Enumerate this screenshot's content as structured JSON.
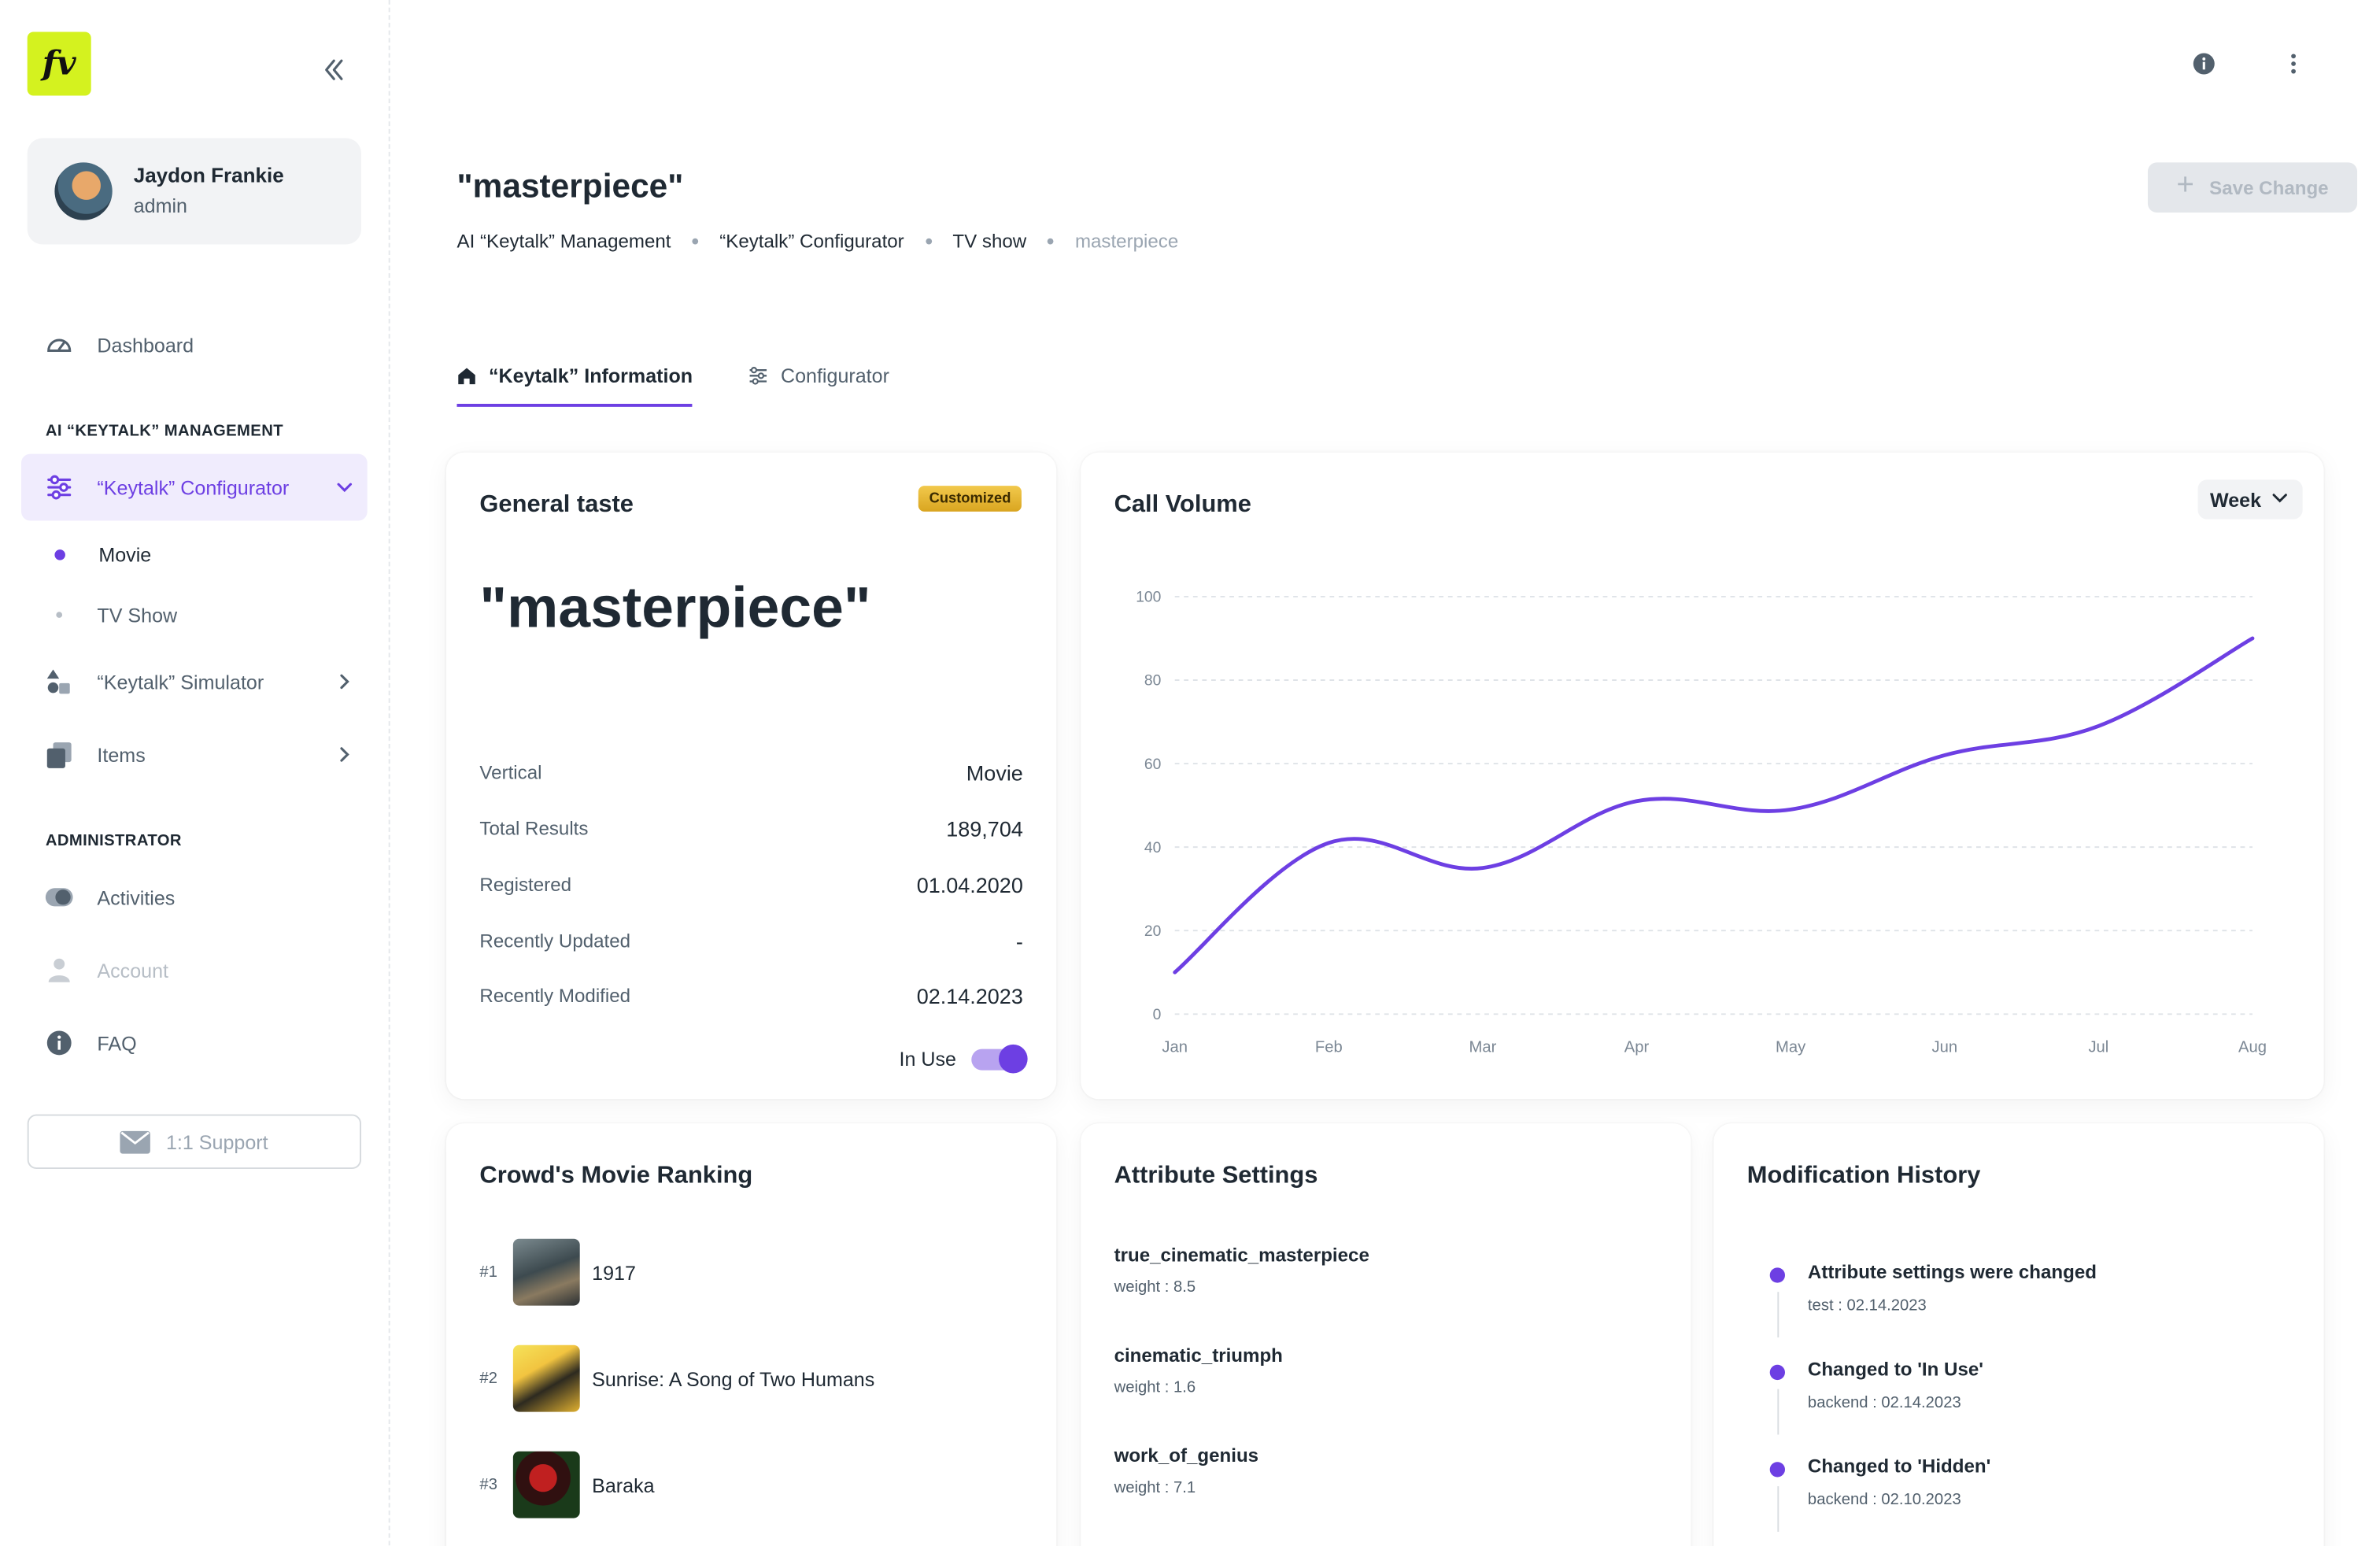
{
  "app": {
    "logo_text": "fv",
    "brand_color": "#d4f21f",
    "accent_color": "#6d3fe3"
  },
  "user": {
    "name": "Jaydon Frankie",
    "role": "admin"
  },
  "sidebar": {
    "dashboard": "Dashboard",
    "section_management": "AI “KEYTALK” MANAGEMENT",
    "configurator": "“Keytalk” Configurator",
    "sub_movie": "Movie",
    "sub_tvshow": "TV Show",
    "simulator": "“Keytalk” Simulator",
    "items": "Items",
    "section_admin": "ADMINISTRATOR",
    "activities": "Activities",
    "account": "Account",
    "faq": "FAQ",
    "support": "1:1 Support"
  },
  "header": {
    "title": "\"masterpiece\"",
    "breadcrumb": [
      "AI “Keytalk” Management",
      "“Keytalk” Configurator",
      "TV show",
      "masterpiece"
    ],
    "save_label": "Save Change"
  },
  "tabs": [
    {
      "label": "“Keytalk” Information",
      "icon": "home-icon",
      "active": true
    },
    {
      "label": "Configurator",
      "icon": "sliders-icon",
      "active": false
    }
  ],
  "general": {
    "title": "General taste",
    "badge": "Customized",
    "keyword": "\"masterpiece\"",
    "rows": [
      {
        "key": "Vertical",
        "value": "Movie"
      },
      {
        "key": "Total Results",
        "value": "189,704"
      },
      {
        "key": "Registered",
        "value": "01.04.2020"
      },
      {
        "key": "Recently Updated",
        "value": "-"
      },
      {
        "key": "Recently Modified",
        "value": "02.14.2023"
      }
    ],
    "in_use_label": "In Use",
    "in_use": true
  },
  "call_volume": {
    "title": "Call Volume",
    "period": "Week"
  },
  "chart_data": {
    "type": "line",
    "title": "Call Volume",
    "categories": [
      "Jan",
      "Feb",
      "Mar",
      "Apr",
      "May",
      "Jun",
      "Jul",
      "Aug"
    ],
    "series": [
      {
        "values": [
          10,
          41,
          35,
          51,
          49,
          62,
          69,
          90
        ],
        "color": "#6d3fe3"
      }
    ],
    "ylim": [
      0,
      100
    ],
    "yticks": [
      0,
      20,
      40,
      60,
      80,
      100
    ],
    "grid": true
  },
  "ranking": {
    "title": "Crowd's Movie Ranking",
    "items": [
      {
        "rank": "#1",
        "title": "1917"
      },
      {
        "rank": "#2",
        "title": "Sunrise: A Song of Two Humans"
      },
      {
        "rank": "#3",
        "title": "Baraka"
      }
    ]
  },
  "attributes": {
    "title": "Attribute Settings",
    "items": [
      {
        "name": "true_cinematic_masterpiece",
        "weight": "weight : 8.5"
      },
      {
        "name": "cinematic_triumph",
        "weight": "weight : 1.6"
      },
      {
        "name": "work_of_genius",
        "weight": "weight : 7.1"
      }
    ]
  },
  "history": {
    "title": "Modification History",
    "items": [
      {
        "title": "Attribute settings were changed",
        "sub": "test : 02.14.2023"
      },
      {
        "title": "Changed to 'In Use'",
        "sub": "backend : 02.14.2023"
      },
      {
        "title": "Changed to 'Hidden'",
        "sub": "backend : 02.10.2023"
      }
    ]
  }
}
